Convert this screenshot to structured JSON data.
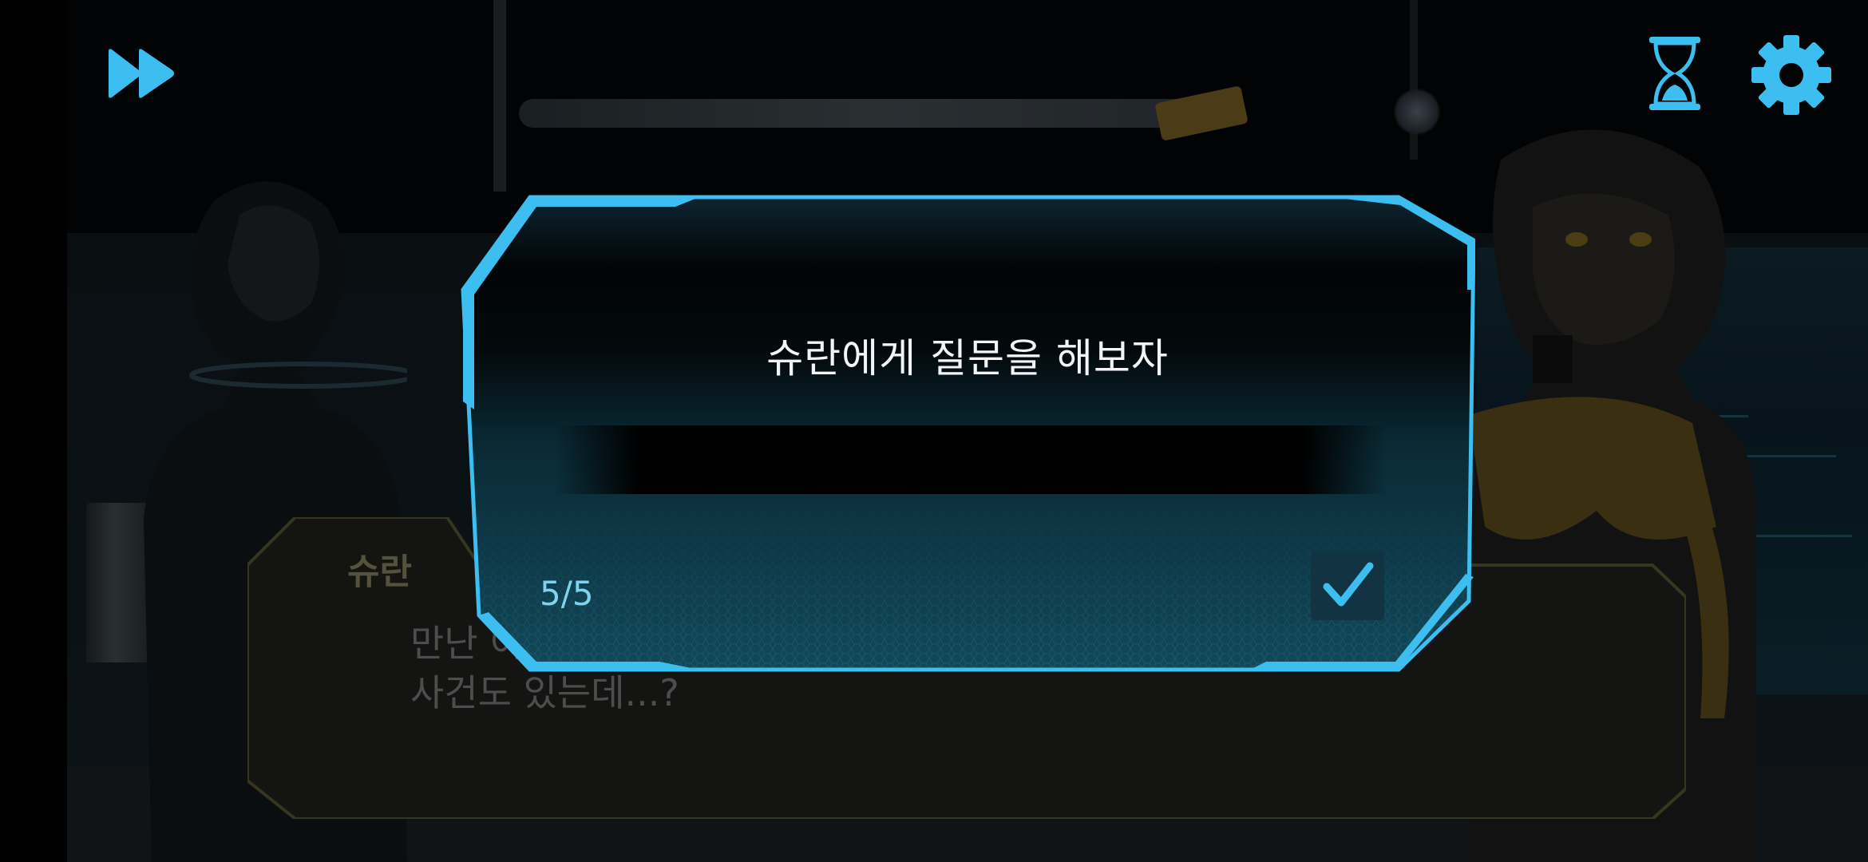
{
  "hud": {
    "fast_forward_icon": "fast-forward-icon",
    "auto_icon": "hourglass-icon",
    "settings_icon": "gear-icon",
    "accent_color": "#3dbef0"
  },
  "dialog": {
    "speaker": "슈란",
    "line1": "만난 이야기도 있지만 이런 일 이해 못할 일들",
    "line2": "사건도 있는데...?"
  },
  "popup": {
    "title": "슈란에게 질문을 해보자",
    "input_value": "",
    "counter": "5/5",
    "confirm_icon": "checkmark-icon",
    "frame_color": "#3dbef0"
  }
}
